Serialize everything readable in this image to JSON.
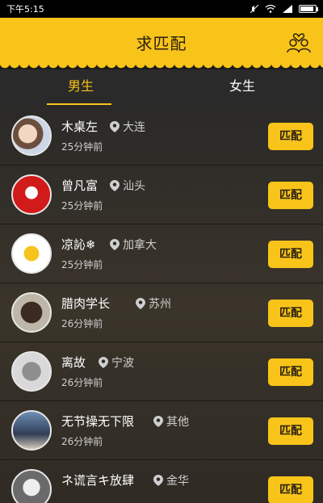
{
  "status_bar": {
    "time": "下午5:15"
  },
  "header": {
    "title": "求匹配"
  },
  "tabs": [
    {
      "label": "男生",
      "active": true
    },
    {
      "label": "女生",
      "active": false
    }
  ],
  "users": [
    {
      "name": "木桌左",
      "location": "大连",
      "time": "25分钟前",
      "button": "匹配"
    },
    {
      "name": "曾凡富",
      "location": "汕头",
      "time": "25分钟前",
      "button": "匹配"
    },
    {
      "name": "凉訫❄",
      "location": "加拿大",
      "time": "25分钟前",
      "button": "匹配"
    },
    {
      "name": "腊肉学长",
      "location": "苏州",
      "time": "26分钟前",
      "button": "匹配"
    },
    {
      "name": "离故",
      "location": "宁波",
      "time": "26分钟前",
      "button": "匹配"
    },
    {
      "name": "无节操无下限",
      "location": "其他",
      "time": "26分钟前",
      "button": "匹配"
    },
    {
      "name": "ネ谎言キ放肆",
      "location": "金华",
      "time": "",
      "button": "匹配"
    }
  ],
  "colors": {
    "accent": "#f8c41a",
    "background": "#2b2a28"
  }
}
